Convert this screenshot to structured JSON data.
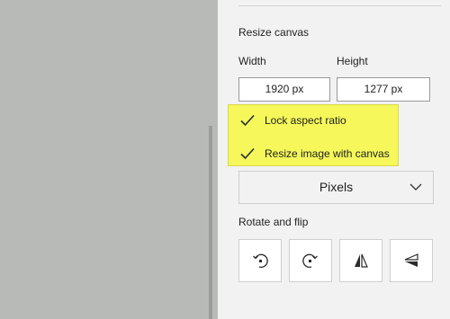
{
  "resize_canvas": {
    "section_title": "Resize canvas",
    "width_label": "Width",
    "height_label": "Height",
    "width_value": "1920 px",
    "height_value": "1277 px"
  },
  "options": {
    "lock_aspect_label": "Lock aspect ratio",
    "lock_aspect_checked": true,
    "resize_image_label": "Resize image with canvas",
    "resize_image_checked": true
  },
  "units": {
    "selected": "Pixels"
  },
  "rotate_flip": {
    "section_title": "Rotate and flip",
    "buttons": [
      {
        "icon": "rotate-left-icon"
      },
      {
        "icon": "rotate-right-icon"
      },
      {
        "icon": "flip-horizontal-icon"
      },
      {
        "icon": "flip-vertical-icon"
      }
    ]
  },
  "colors": {
    "highlight": "#f5f75a",
    "checkmark": "#2b2b2b",
    "canvas_bg": "#b8bab8",
    "panel_bg": "#f2f2f2"
  }
}
